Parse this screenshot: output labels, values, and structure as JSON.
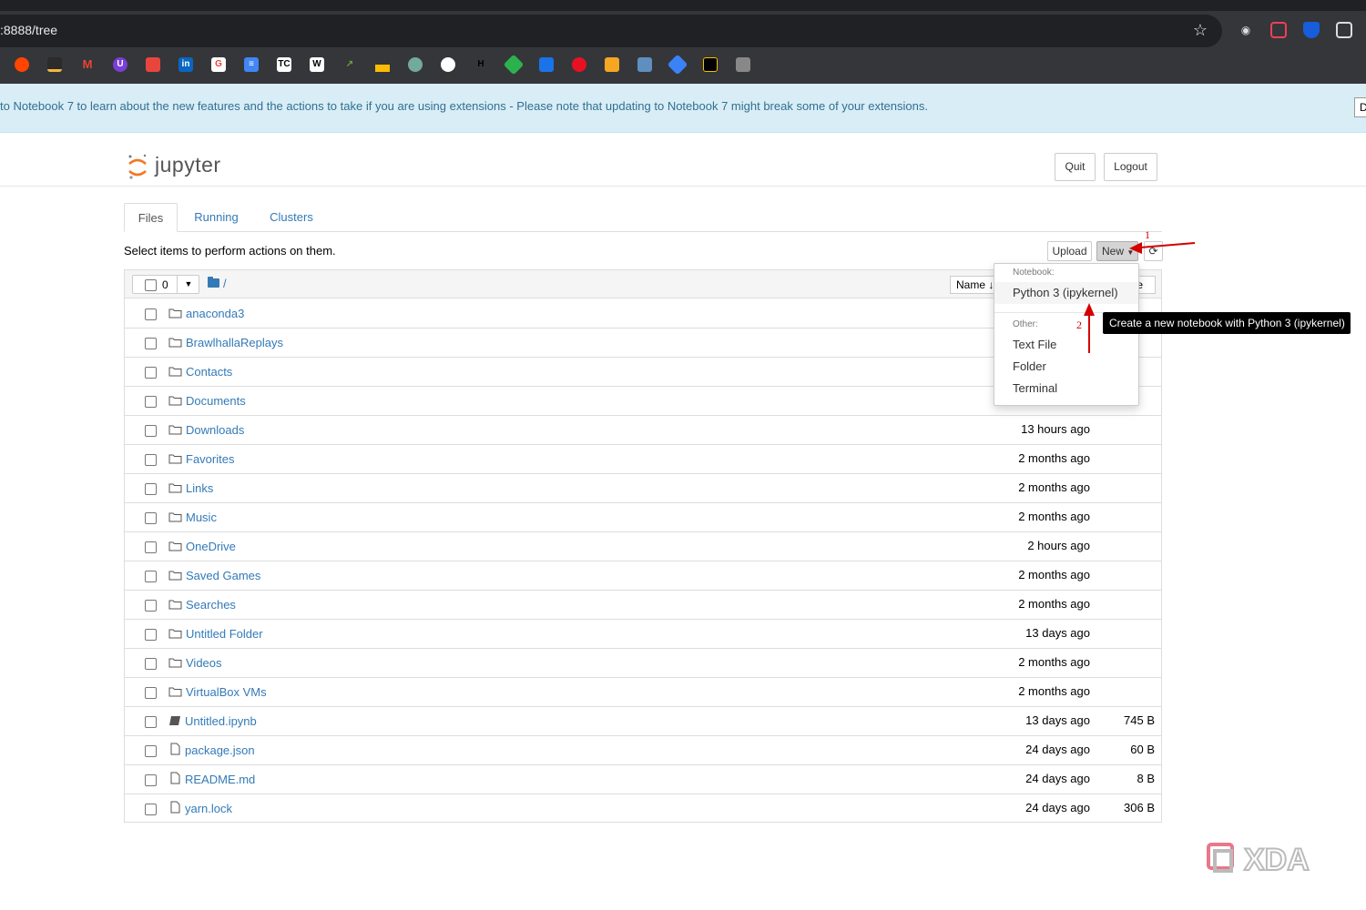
{
  "browser": {
    "url": ":8888/tree",
    "bookmark_icons": [
      "reddit-icon",
      "chart-icon",
      "gmail-icon",
      "app-icon",
      "store-icon",
      "linkedin-icon",
      "google-icon",
      "docs-icon",
      "tc-icon",
      "wiki-icon",
      "arrow-ext-icon",
      "drive-icon",
      "chatgpt-icon",
      "gear-ext-icon",
      "h-icon",
      "feedly-icon",
      "chat-icon",
      "circle-icon",
      "box-icon",
      "sheet-icon",
      "gem-icon",
      "tradingview-icon",
      "stack-icon"
    ],
    "colors": {
      "chrome_bg": "#35363a",
      "omnibox_bg": "#202124"
    }
  },
  "notice": {
    "text": "to Notebook 7 to learn about the new features and the actions to take if you are using extensions - Please note that updating to Notebook 7 might break some of your extensions.",
    "button_label": "D"
  },
  "header": {
    "logo_text": "jupyter",
    "quit_label": "Quit",
    "logout_label": "Logout"
  },
  "tabs": [
    {
      "label": "Files",
      "active": true
    },
    {
      "label": "Running",
      "active": false
    },
    {
      "label": "Clusters",
      "active": false
    }
  ],
  "toolbar": {
    "select_text": "Select items to perform actions on them.",
    "upload_label": "Upload",
    "new_label": "New",
    "selected_count": "0",
    "breadcrumb": "/",
    "sort_name_label": "Name",
    "sort_col2_label": "te"
  },
  "files": [
    {
      "name": "anaconda3",
      "type": "folder",
      "date": "",
      "size": ""
    },
    {
      "name": "BrawlhallaReplays",
      "type": "folder",
      "date": "",
      "size": ""
    },
    {
      "name": "Contacts",
      "type": "folder",
      "date": "",
      "size": ""
    },
    {
      "name": "Documents",
      "type": "folder",
      "date": "",
      "size": ""
    },
    {
      "name": "Downloads",
      "type": "folder",
      "date": "13 hours ago",
      "size": ""
    },
    {
      "name": "Favorites",
      "type": "folder",
      "date": "2 months ago",
      "size": ""
    },
    {
      "name": "Links",
      "type": "folder",
      "date": "2 months ago",
      "size": ""
    },
    {
      "name": "Music",
      "type": "folder",
      "date": "2 months ago",
      "size": ""
    },
    {
      "name": "OneDrive",
      "type": "folder",
      "date": "2 hours ago",
      "size": ""
    },
    {
      "name": "Saved Games",
      "type": "folder",
      "date": "2 months ago",
      "size": ""
    },
    {
      "name": "Searches",
      "type": "folder",
      "date": "2 months ago",
      "size": ""
    },
    {
      "name": "Untitled Folder",
      "type": "folder",
      "date": "13 days ago",
      "size": ""
    },
    {
      "name": "Videos",
      "type": "folder",
      "date": "2 months ago",
      "size": ""
    },
    {
      "name": "VirtualBox VMs",
      "type": "folder",
      "date": "2 months ago",
      "size": ""
    },
    {
      "name": "Untitled.ipynb",
      "type": "notebook",
      "date": "13 days ago",
      "size": "745 B"
    },
    {
      "name": "package.json",
      "type": "file",
      "date": "24 days ago",
      "size": "60 B"
    },
    {
      "name": "README.md",
      "type": "file",
      "date": "24 days ago",
      "size": "8 B"
    },
    {
      "name": "yarn.lock",
      "type": "file",
      "date": "24 days ago",
      "size": "306 B"
    }
  ],
  "new_menu": {
    "notebook_header": "Notebook:",
    "python_item": "Python 3 (ipykernel)",
    "other_header": "Other:",
    "other_items": [
      "Text File",
      "Folder",
      "Terminal"
    ]
  },
  "tooltip": "Create a new notebook with Python 3 (ipykernel)",
  "annotations": {
    "step1": "1",
    "step2": "2",
    "color": "#d40000"
  },
  "watermark": "XDA"
}
